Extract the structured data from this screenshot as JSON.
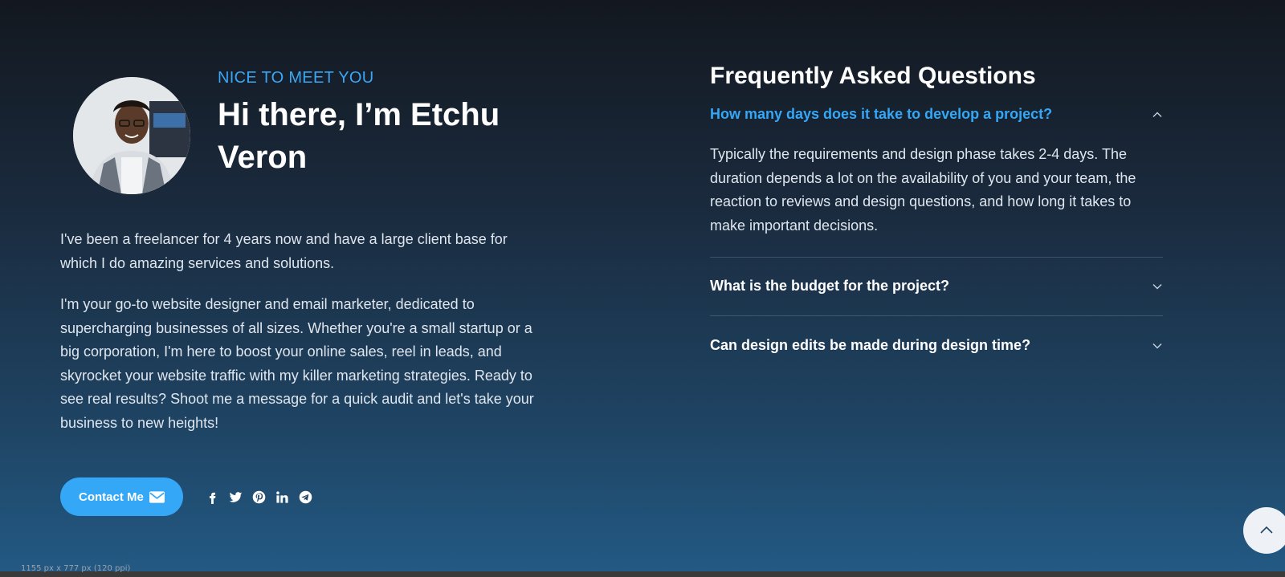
{
  "intro": {
    "eyebrow": "NICE TO MEET YOU",
    "heading": "Hi there, I’m Etchu Veron",
    "paragraphs": [
      "I've been a freelancer for 4 years now and have a large client base for which I do amazing services and solutions.",
      "I'm your go-to website designer and email marketer, dedicated to supercharging businesses of all sizes. Whether you're a small startup or a big corporation, I'm here to boost your online sales, reel in leads, and skyrocket your website traffic with my killer marketing strategies. Ready to see real results? Shoot me a message for a quick audit and let's take your business to new heights!"
    ],
    "contact_label": "Contact Me",
    "socials": [
      "facebook-icon",
      "twitter-icon",
      "pinterest-icon",
      "linkedin-icon",
      "telegram-icon"
    ]
  },
  "faq": {
    "title": "Frequently Asked Questions",
    "items": [
      {
        "question": "How many days does it take to develop a project?",
        "answer": "Typically the requirements and design phase takes 2-4 days. The duration depends a lot on the availability of you and your team, the reaction to reviews and design questions, and how long it takes to make important decisions.",
        "expanded": true
      },
      {
        "question": "What is the budget for the project?",
        "answer": "",
        "expanded": false
      },
      {
        "question": "Can design edits be made during design time?",
        "answer": "",
        "expanded": false
      }
    ]
  },
  "statusbar": {
    "text": "1155 px x 777 px (120 ppi)"
  },
  "colors": {
    "accent": "#35a7f7",
    "text": "#ffffff",
    "muted": "#dfe6ee"
  }
}
